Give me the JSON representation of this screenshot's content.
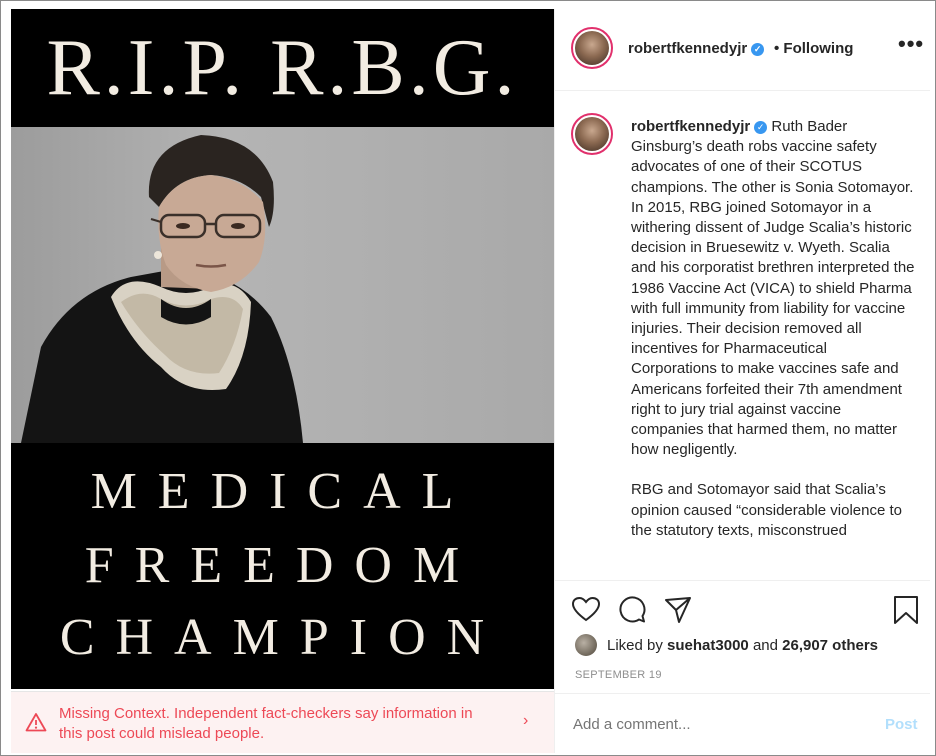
{
  "image": {
    "headline": "R.I.P. R.B.G.",
    "lines": [
      "MEDICAL",
      "FREEDOM",
      "CHAMPION"
    ]
  },
  "warning": {
    "text": "Missing Context. Independent fact-checkers say information in this post could mislead people.",
    "icon": "warning-triangle-icon",
    "chevron": "›",
    "color": "#ed4956"
  },
  "header": {
    "username": "robertfkennedyjr",
    "verified_glyph": "✓",
    "following": "• Following",
    "more": "•••"
  },
  "caption": {
    "username": "robertfkennedyjr",
    "paragraph1": "Ruth Bader Ginsburg’s death robs vaccine safety advocates of one of their SCOTUS champions. The other is Sonia Sotomayor. In 2015, RBG joined Sotomayor in a withering dissent of Judge Scalia’s historic decision in Bruesewitz v. Wyeth. Scalia and his corporatist brethren interpreted the 1986 Vaccine Act (VICA) to shield Pharma with full immunity from liability for vaccine injuries. Their decision removed all incentives for Pharmaceutical Corporations to make vaccines safe and Americans forfeited their 7th amendment right to jury trial against vaccine companies that harmed them, no matter how negligently.",
    "paragraph2": "RBG and Sotomayor said that Scalia’s opinion caused “considerable violence to the statutory texts, misconstrued"
  },
  "actions": {
    "icons": [
      "heart-icon",
      "comment-icon",
      "share-icon",
      "bookmark-icon"
    ],
    "liked_by_prefix": "Liked by",
    "liked_by_user": "suehat3000",
    "and": "and",
    "others": "26,907 others",
    "date": "SEPTEMBER 19"
  },
  "comment": {
    "placeholder": "Add a comment...",
    "post_label": "Post"
  }
}
